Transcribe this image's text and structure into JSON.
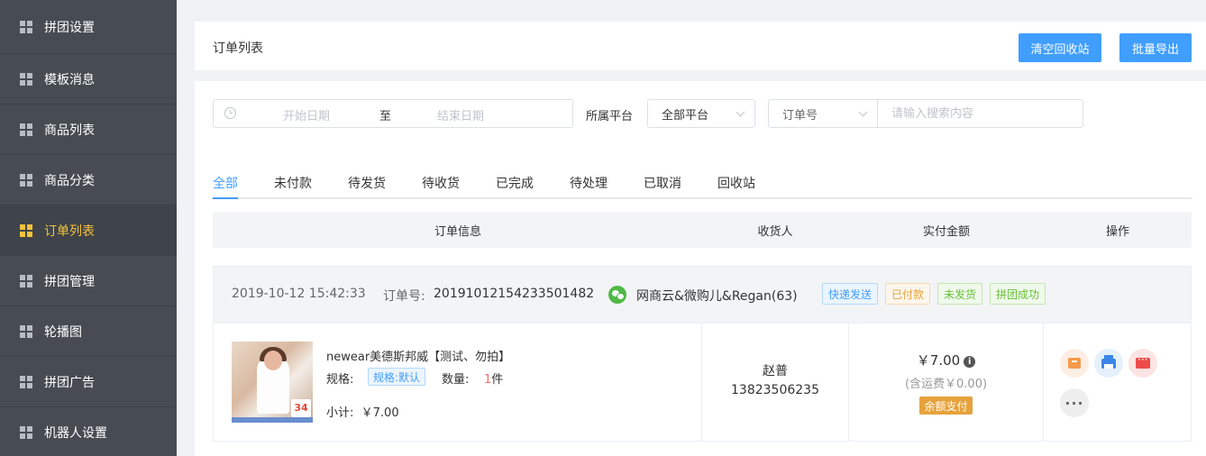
{
  "sidebar": {
    "items": [
      {
        "label": "拼团设置"
      },
      {
        "label": "模板消息"
      },
      {
        "label": "商品列表"
      },
      {
        "label": "商品分类"
      },
      {
        "label": "订单列表",
        "active": true
      },
      {
        "label": "拼团管理"
      },
      {
        "label": "轮播图"
      },
      {
        "label": "拼团广告"
      },
      {
        "label": "机器人设置"
      }
    ],
    "active_color": "#f5c23c",
    "icon": "grid-icon"
  },
  "header": {
    "title": "订单列表",
    "clear_recycle_label": "清空回收站",
    "batch_export_label": "批量导出",
    "button_color": "#409eff"
  },
  "filters": {
    "start_date_placeholder": "开始日期",
    "range_separator": "至",
    "end_date_placeholder": "结束日期",
    "platform_label": "所属平台",
    "platform_value": "全部平台",
    "search_type_value": "订单号",
    "search_placeholder": "请输入搜索内容"
  },
  "tabs": [
    {
      "label": "全部",
      "active": true
    },
    {
      "label": "未付款"
    },
    {
      "label": "待发货"
    },
    {
      "label": "待收货"
    },
    {
      "label": "已完成"
    },
    {
      "label": "待处理"
    },
    {
      "label": "已取消"
    },
    {
      "label": "回收站"
    }
  ],
  "table": {
    "columns": [
      "订单信息",
      "收货人",
      "实付金额",
      "操作"
    ]
  },
  "order": {
    "datetime": "2019-10-12 15:42:33",
    "order_no_label": "订单号:",
    "order_no": "20191012154233501482",
    "buyer": "网商云&微购儿&Regan(63)",
    "tags": [
      {
        "label": "快递发送",
        "color": "#409eff"
      },
      {
        "label": "已付款",
        "color": "#e6a23c"
      },
      {
        "label": "未发货",
        "color": "#67c23a"
      },
      {
        "label": "拼团成功",
        "color": "#67c23a"
      }
    ],
    "product": {
      "name": "newear美德斯邦威【测试、勿拍】",
      "spec_label": "规格:",
      "spec_value": "规格:默认",
      "qty_label": "数量:",
      "qty_value": "1",
      "qty_unit": "件",
      "subtotal_label": "小计:",
      "subtotal_value": "￥7.00",
      "thumb_badge": "34"
    },
    "receiver": {
      "name": "赵普",
      "phone": "13823506235"
    },
    "payment": {
      "amount": "￥7.00",
      "freight": "(含运费￥0.00)",
      "method": "余额支付"
    },
    "actions": [
      "ship-icon",
      "print-icon",
      "message-icon",
      "more-icon"
    ]
  }
}
